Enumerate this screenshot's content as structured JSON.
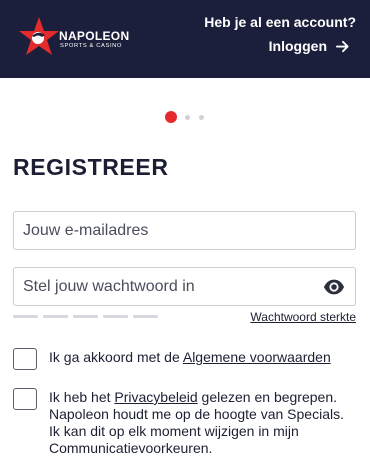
{
  "header": {
    "logo": {
      "name": "NAPOLEON",
      "subtitle": "SPORTS & CASINO"
    },
    "account_question": "Heb je al een account?",
    "login_label": "Inloggen"
  },
  "steps": {
    "total": 3,
    "current": 1
  },
  "form": {
    "title": "REGISTREER",
    "email": {
      "placeholder": "Jouw e-mailadres",
      "value": ""
    },
    "password": {
      "placeholder": "Stel jouw wachtwoord in",
      "value": ""
    },
    "password_strength_label": "Wachtwoord sterkte",
    "terms": {
      "prefix": "Ik ga akkoord met de ",
      "link": "Algemene voorwaarden",
      "checked": false
    },
    "privacy": {
      "prefix": "Ik heb het ",
      "link": "Privacybeleid",
      "line1_suffix": " gelezen en begrepen.",
      "line2": "Napoleon houdt me op de hoogte van Specials.",
      "line3": "Ik kan dit op elk moment wijzigen in mijn",
      "line4": "Communicatievoorkeuren.",
      "checked": false
    }
  },
  "colors": {
    "header_bg": "#1c1f3b",
    "accent": "#e32b2e",
    "text": "#1c2033"
  }
}
